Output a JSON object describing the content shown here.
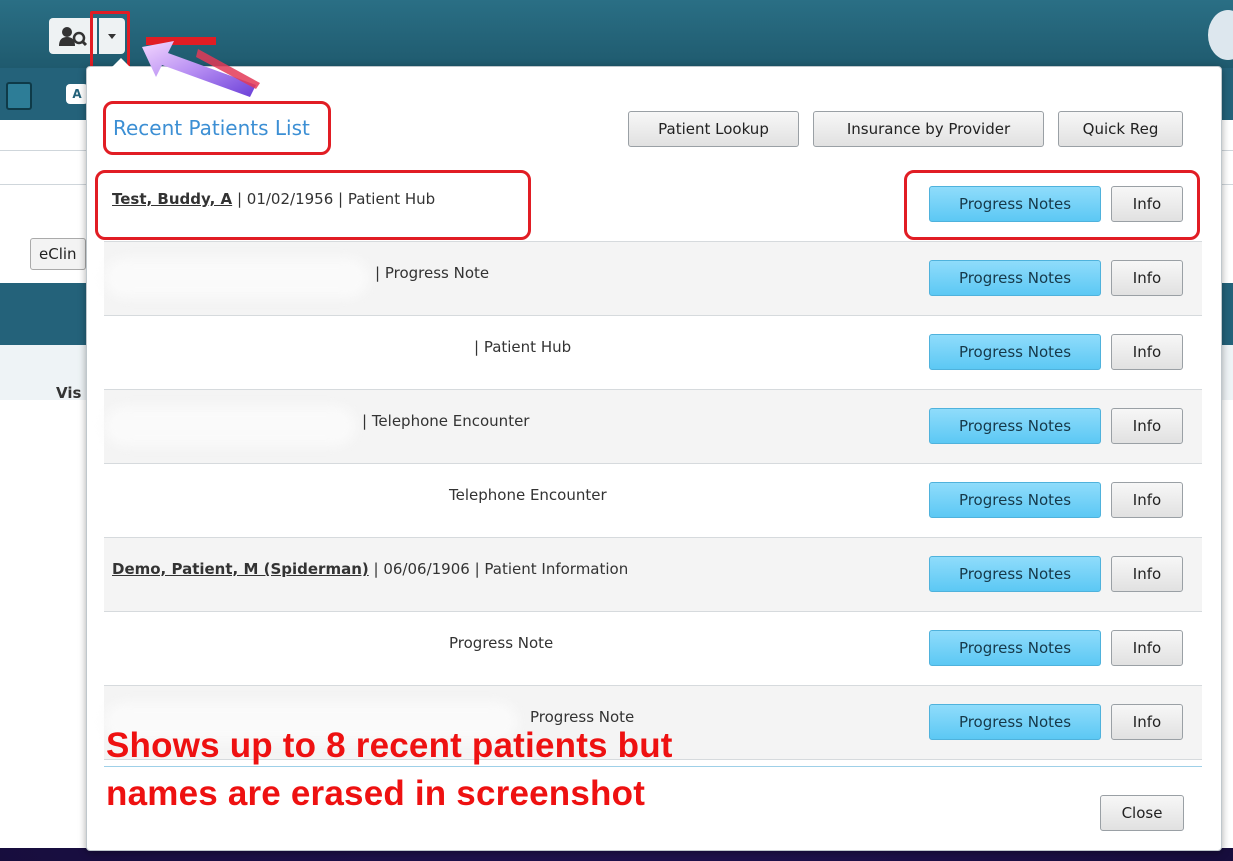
{
  "background": {
    "toolbar_letter": "A",
    "eclin_label": "eClin",
    "vis_label": "Vis"
  },
  "popup": {
    "title": "Recent Patients List",
    "header_buttons": [
      "Patient Lookup",
      "Insurance by Provider",
      "Quick Reg"
    ],
    "rows": [
      {
        "name": "Test, Buddy, A",
        "dob": "01/02/1956",
        "context": "Patient Hub",
        "name_visible": true
      },
      {
        "name": "",
        "dob": "",
        "context": "| Progress Note",
        "name_visible": false
      },
      {
        "name": "",
        "dob": "",
        "context": "| Patient Hub",
        "name_visible": false
      },
      {
        "name": "",
        "dob": "",
        "context": "| Telephone Encounter",
        "name_visible": false
      },
      {
        "name": "",
        "dob": "",
        "context": "Telephone Encounter",
        "name_visible": false
      },
      {
        "name": "Demo, Patient, M (Spiderman)",
        "dob": "06/06/1906",
        "context": "Patient Information",
        "name_visible": true
      },
      {
        "name": "",
        "dob": "",
        "context": "Progress Note",
        "name_visible": false
      },
      {
        "name": "",
        "dob": "",
        "context": "Progress Note",
        "name_visible": false
      }
    ],
    "progress_notes_label": "Progress Notes",
    "info_label": "Info",
    "close_label": "Close"
  },
  "annotation": {
    "line1": "Shows up to 8 recent patients but",
    "line2": "names are erased in screenshot",
    "color": "#ee1111"
  },
  "colors": {
    "highlight": "#e11d24",
    "accent_blue": "#3c8fd4",
    "progress_btn": "#5cc8f4",
    "app_bar": "#24627a"
  }
}
